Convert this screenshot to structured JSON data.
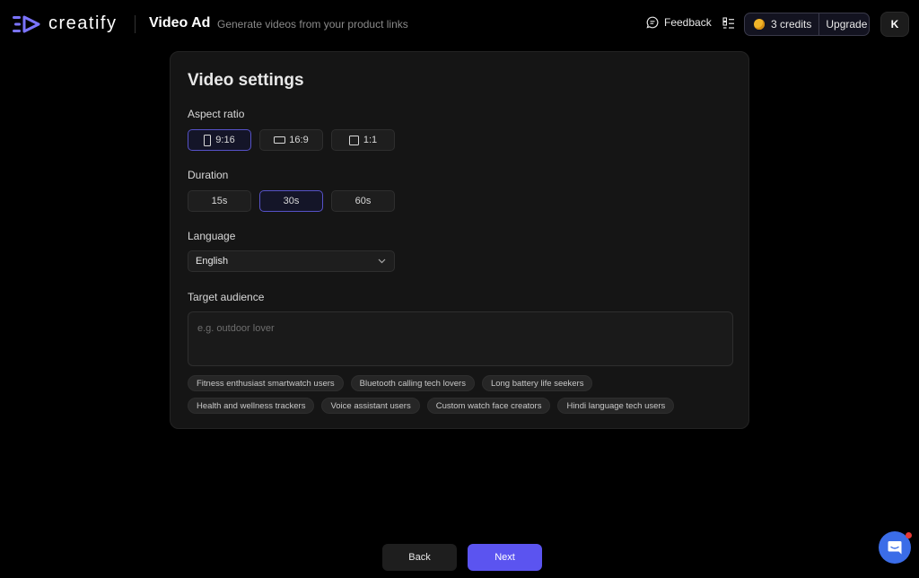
{
  "header": {
    "logo_text": "creatify",
    "title": "Video Ad",
    "subtitle": "Generate videos from your product links",
    "feedback_label": "Feedback",
    "credits_label": "3 credits",
    "upgrade_label": "Upgrade",
    "avatar_initial": "K"
  },
  "settings": {
    "title": "Video settings",
    "aspect_ratio": {
      "label": "Aspect ratio",
      "options": [
        "9:16",
        "16:9",
        "1:1"
      ],
      "selected": "9:16"
    },
    "duration": {
      "label": "Duration",
      "options": [
        "15s",
        "30s",
        "60s"
      ],
      "selected": "30s"
    },
    "language": {
      "label": "Language",
      "value": "English"
    },
    "target_audience": {
      "label": "Target audience",
      "placeholder": "e.g. outdoor lover",
      "value": "",
      "suggestions": [
        "Fitness enthusiast smartwatch users",
        "Bluetooth calling tech lovers",
        "Long battery life seekers",
        "Health and wellness trackers",
        "Voice assistant users",
        "Custom watch face creators",
        "Hindi language tech users"
      ]
    }
  },
  "footer": {
    "back_label": "Back",
    "next_label": "Next"
  },
  "colors": {
    "accent": "#5b54f0",
    "selected_border": "#5652c8",
    "coin": "#f0b429",
    "chat": "#3b6de8"
  },
  "icons": {
    "logo": "creatify-logo-icon",
    "feedback": "feedback-bubble-icon",
    "list": "checklist-icon",
    "coin": "coin-icon",
    "dropdown": "chevron-down-icon",
    "chat": "chat-icon"
  }
}
